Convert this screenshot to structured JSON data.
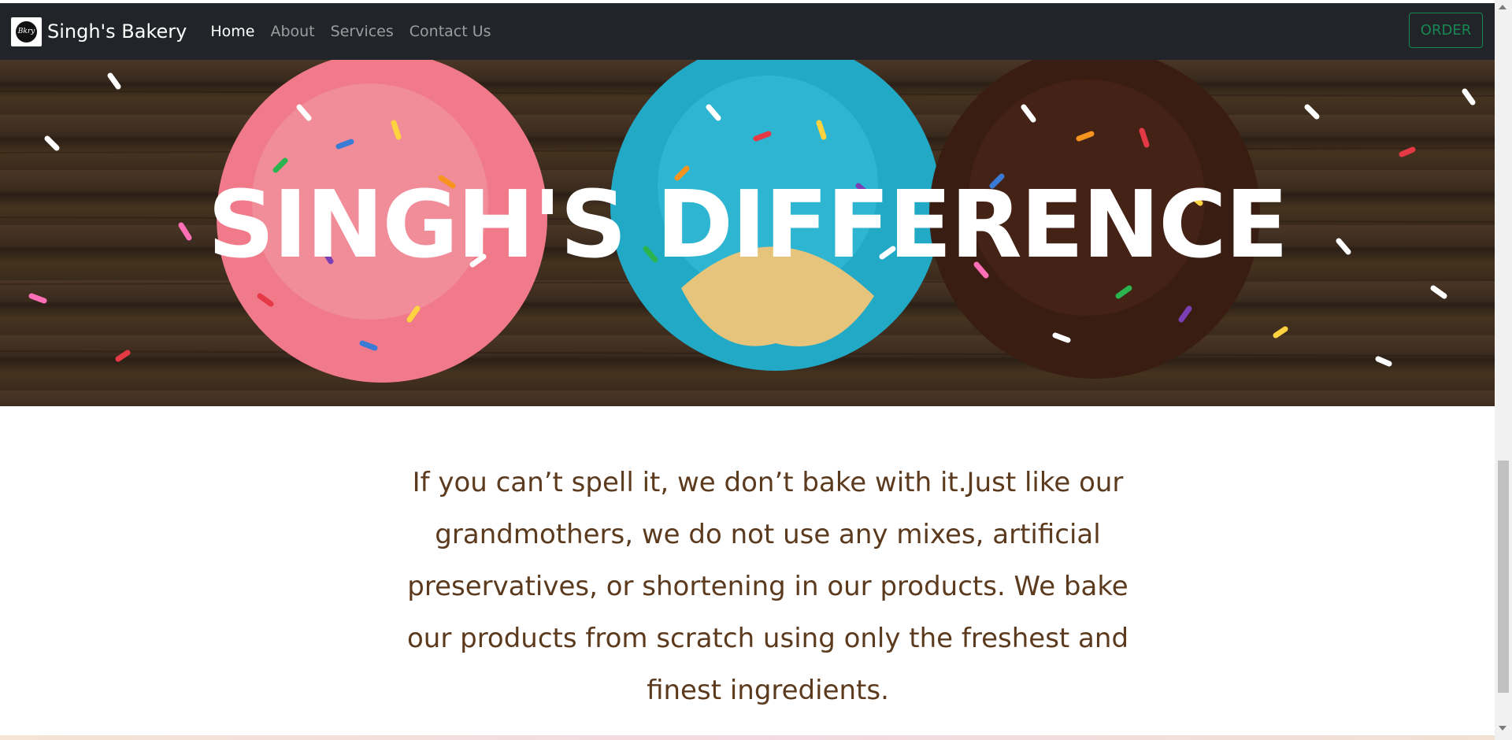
{
  "navbar": {
    "brand": {
      "name": "Singh's Bakery",
      "logo_icon": "bakery-logo-icon"
    },
    "links": [
      {
        "label": "Home",
        "active": true
      },
      {
        "label": "About",
        "active": false
      },
      {
        "label": "Services",
        "active": false
      },
      {
        "label": "Contact Us",
        "active": false
      }
    ],
    "order_label": "ORDER"
  },
  "hero": {
    "title": "SINGH'S DIFFERENCE",
    "image": "donuts-with-sprinkles"
  },
  "content": {
    "text": "If you can’t spell it, we don’t bake with it.Just like our grandmothers, we do not use any mixes, artificial preservatives, or shortening in our products. We bake our products from scratch using only the freshest and finest ingredients."
  },
  "colors": {
    "navbar_bg": "#212529",
    "order_accent": "#198754",
    "content_text": "#5c3a1e"
  }
}
